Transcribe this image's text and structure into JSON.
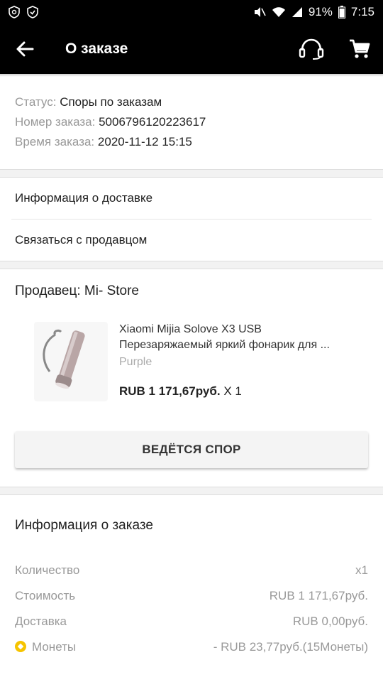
{
  "statusbar": {
    "battery": "91%",
    "time": "7:15"
  },
  "appbar": {
    "title": "О заказе"
  },
  "order": {
    "status_label": "Статус:",
    "status_value": "Споры по заказам",
    "number_label": "Номер заказа:",
    "number_value": "5006796120223617",
    "time_label": "Время заказа:",
    "time_value": "2020-11-12 15:15"
  },
  "links": {
    "delivery": "Информация о доставке",
    "contact": "Связаться с продавцом"
  },
  "seller": {
    "label": "Продавец: Mi- Store"
  },
  "product": {
    "name_line1": "Xiaomi Mijia Solove X3 USB",
    "name_line2": "Перезаряжаемый яркий фонарик для ...",
    "variant": "Purple",
    "price": "RUB 1 171,67руб.",
    "qty": "X 1"
  },
  "dispute_button": "ВЕДЁТСЯ СПОР",
  "order_info": {
    "title": "Информация о заказе",
    "rows": [
      {
        "label": "Количество",
        "value": "x1"
      },
      {
        "label": "Стоимость",
        "value": "RUB 1 171,67руб."
      },
      {
        "label": "Доставка",
        "value": "RUB 0,00руб."
      },
      {
        "label": "Монеты",
        "value": "- RUB 23,77руб.(15Монеты)"
      }
    ]
  },
  "colors": {
    "coin": "#f6c400",
    "appbar": "#000000"
  }
}
